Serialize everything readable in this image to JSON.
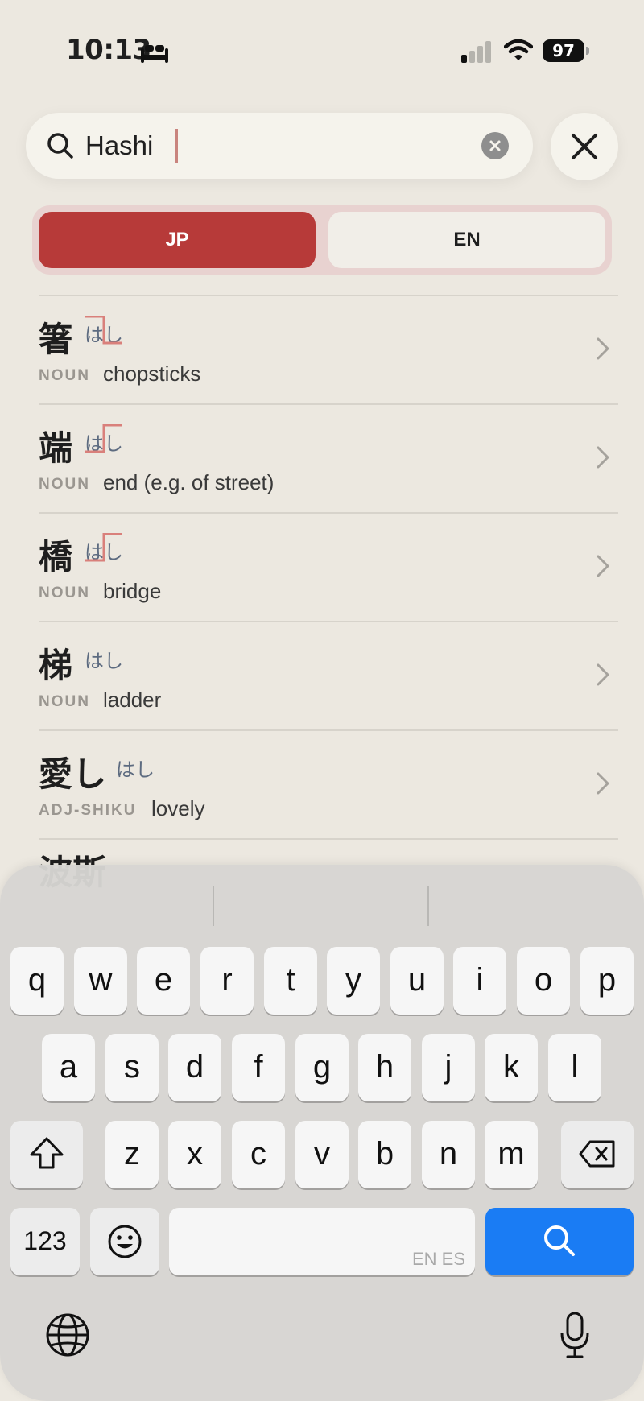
{
  "status_bar": {
    "time": "10:13",
    "battery": "97"
  },
  "search": {
    "value": "Hashi"
  },
  "segmented": {
    "jp_label": "JP",
    "en_label": "EN"
  },
  "results": [
    {
      "kanji": "箸",
      "reading": "はし",
      "pos": "NOUN",
      "meaning": "chopsticks"
    },
    {
      "kanji": "端",
      "reading": "はし",
      "pos": "NOUN",
      "meaning": "end (e.g. of street)"
    },
    {
      "kanji": "橋",
      "reading": "はし",
      "pos": "NOUN",
      "meaning": "bridge"
    },
    {
      "kanji": "梯",
      "reading": "はし",
      "pos": "NOUN",
      "meaning": "ladder"
    },
    {
      "kanji": "愛し",
      "reading": "はし",
      "pos": "ADJ-SHIKU",
      "meaning": "lovely"
    }
  ],
  "partial_result": {
    "kanji": "波斯"
  },
  "keyboard": {
    "row1": [
      "q",
      "w",
      "e",
      "r",
      "t",
      "y",
      "u",
      "i",
      "o",
      "p"
    ],
    "row2": [
      "a",
      "s",
      "d",
      "f",
      "g",
      "h",
      "j",
      "k",
      "l"
    ],
    "row3": [
      "z",
      "x",
      "c",
      "v",
      "b",
      "n",
      "m"
    ],
    "numbers_label": "123",
    "space_languages": "EN ES"
  },
  "colors": {
    "accent": "#b73a39",
    "search_key": "#1a7cf4",
    "background": "#ece8e0"
  },
  "icons": [
    "bed-icon",
    "signal-icon",
    "wifi-icon",
    "search-icon",
    "clear-icon",
    "close-icon",
    "chevron-right-icon",
    "shift-icon",
    "delete-icon",
    "emoji-icon",
    "globe-icon",
    "microphone-icon"
  ]
}
